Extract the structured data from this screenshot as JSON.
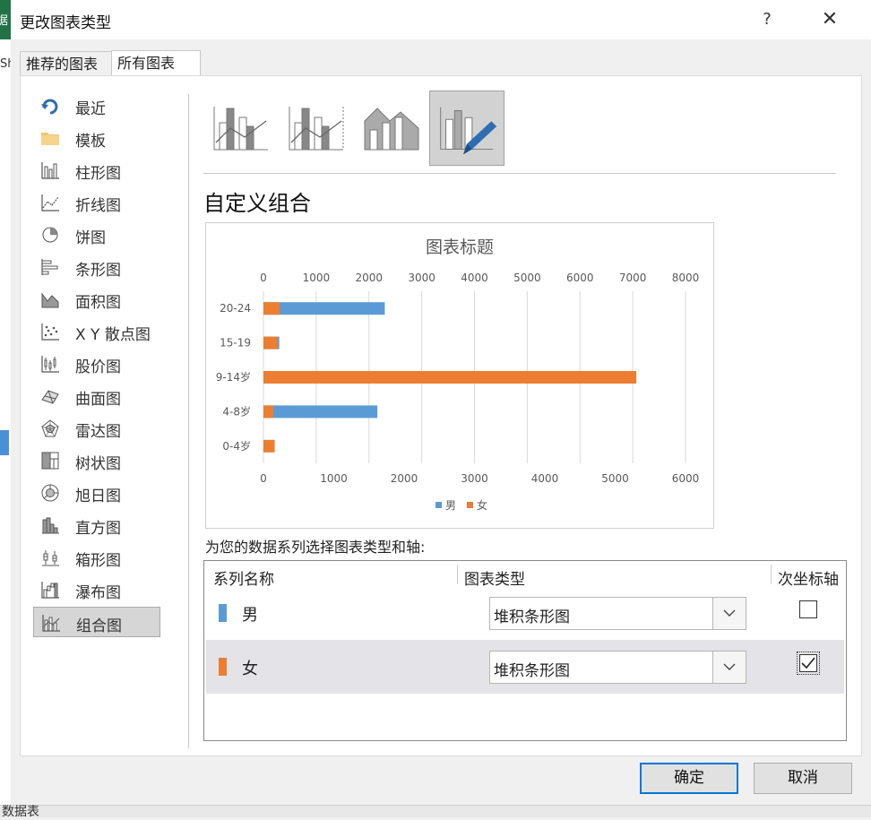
{
  "background": {
    "left_fragment": "据",
    "sheet_fragment": "Sh",
    "bottom_fragment": "数据表"
  },
  "dialog": {
    "title": "更改图表类型",
    "help_symbol": "?",
    "close_symbol": "✕"
  },
  "tabs": [
    {
      "label": "推荐的图表",
      "active": false
    },
    {
      "label": "所有图表",
      "active": true
    }
  ],
  "sidebar": {
    "items": [
      {
        "label": "最近",
        "icon": "recent-icon"
      },
      {
        "label": "模板",
        "icon": "folder-icon"
      },
      {
        "label": "柱形图",
        "icon": "column-chart-icon"
      },
      {
        "label": "折线图",
        "icon": "line-chart-icon"
      },
      {
        "label": "饼图",
        "icon": "pie-chart-icon"
      },
      {
        "label": "条形图",
        "icon": "bar-chart-icon"
      },
      {
        "label": "面积图",
        "icon": "area-chart-icon"
      },
      {
        "label": "X Y 散点图",
        "icon": "scatter-chart-icon"
      },
      {
        "label": "股价图",
        "icon": "stock-chart-icon"
      },
      {
        "label": "曲面图",
        "icon": "surface-chart-icon"
      },
      {
        "label": "雷达图",
        "icon": "radar-chart-icon"
      },
      {
        "label": "树状图",
        "icon": "treemap-chart-icon"
      },
      {
        "label": "旭日图",
        "icon": "sunburst-chart-icon"
      },
      {
        "label": "直方图",
        "icon": "histogram-chart-icon"
      },
      {
        "label": "箱形图",
        "icon": "box-chart-icon"
      },
      {
        "label": "瀑布图",
        "icon": "waterfall-chart-icon"
      },
      {
        "label": "组合图",
        "icon": "combo-chart-icon",
        "selected": true
      }
    ]
  },
  "combo_types": [
    {
      "icon": "clustered-column-line-icon"
    },
    {
      "icon": "clustered-column-line-secondary-icon"
    },
    {
      "icon": "stacked-area-column-icon"
    },
    {
      "icon": "custom-combination-icon",
      "selected": true
    }
  ],
  "section_title": "自定义组合",
  "chart_data": {
    "type": "bar",
    "stacked": false,
    "orientation": "horizontal",
    "title": "图表标题",
    "categories": [
      "20-24",
      "15-19",
      "9-14岁",
      "4-8岁",
      "0-4岁"
    ],
    "series": [
      {
        "name": "男",
        "color": "#5b9bd5",
        "axis": "top",
        "values": [
          2300,
          300,
          0,
          2160,
          0
        ]
      },
      {
        "name": "女",
        "color": "#ed7d31",
        "axis": "bottom",
        "values": [
          230,
          200,
          5300,
          140,
          160
        ]
      }
    ],
    "top_axis": {
      "min": 0,
      "max": 8000,
      "ticks": [
        "0",
        "1000",
        "2000",
        "3000",
        "4000",
        "5000",
        "6000",
        "7000",
        "8000"
      ]
    },
    "bottom_axis": {
      "min": 0,
      "max": 6000,
      "ticks": [
        "0",
        "1000",
        "2000",
        "3000",
        "4000",
        "5000",
        "6000"
      ]
    },
    "legend_position": "bottom",
    "grid": true
  },
  "series_table": {
    "label": "为您的数据系列选择图表类型和轴:",
    "headers": {
      "name": "系列名称",
      "type": "图表类型",
      "secondary": "次坐标轴"
    },
    "rows": [
      {
        "name": "男",
        "color": "#5b9bd5",
        "chart_type": "堆积条形图",
        "secondary_axis": false
      },
      {
        "name": "女",
        "color": "#ed7d31",
        "chart_type": "堆积条形图",
        "secondary_axis": true
      }
    ]
  },
  "buttons": {
    "ok": "确定",
    "cancel": "取消"
  }
}
